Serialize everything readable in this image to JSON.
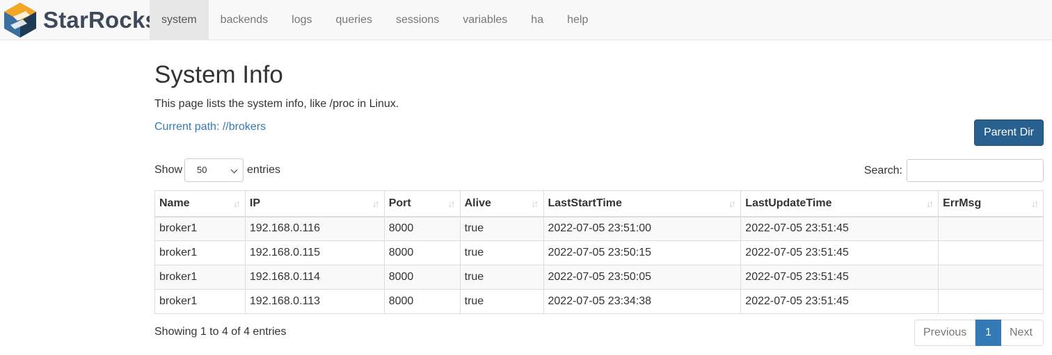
{
  "brand": {
    "name": "StarRocks",
    "logo_icon": "starrocks-logo-icon"
  },
  "nav": {
    "items": [
      {
        "label": "system",
        "active": true
      },
      {
        "label": "backends"
      },
      {
        "label": "logs"
      },
      {
        "label": "queries"
      },
      {
        "label": "sessions"
      },
      {
        "label": "variables"
      },
      {
        "label": "ha"
      },
      {
        "label": "help"
      }
    ]
  },
  "page": {
    "title": "System Info",
    "description": "This page lists the system info, like /proc in Linux.",
    "current_path": "Current path: //brokers",
    "parent_dir_label": "Parent Dir"
  },
  "table_controls": {
    "show_label": "Show",
    "page_length": "50",
    "entries_label": "entries",
    "search_label": "Search:",
    "search_value": ""
  },
  "table": {
    "columns": [
      "Name",
      "IP",
      "Port",
      "Alive",
      "LastStartTime",
      "LastUpdateTime",
      "ErrMsg"
    ],
    "rows": [
      [
        "broker1",
        "192.168.0.116",
        "8000",
        "true",
        "2022-07-05 23:51:00",
        "2022-07-05 23:51:45",
        ""
      ],
      [
        "broker1",
        "192.168.0.115",
        "8000",
        "true",
        "2022-07-05 23:50:15",
        "2022-07-05 23:51:45",
        ""
      ],
      [
        "broker1",
        "192.168.0.114",
        "8000",
        "true",
        "2022-07-05 23:50:05",
        "2022-07-05 23:51:45",
        ""
      ],
      [
        "broker1",
        "192.168.0.113",
        "8000",
        "true",
        "2022-07-05 23:34:38",
        "2022-07-05 23:51:45",
        ""
      ]
    ]
  },
  "footer": {
    "info": "Showing 1 to 4 of 4 entries",
    "previous_label": "Previous",
    "current_page": "1",
    "next_label": "Next"
  },
  "colors": {
    "link": "#337ab7",
    "primary_button": "#286090",
    "navbar": "#f8f8f8"
  }
}
